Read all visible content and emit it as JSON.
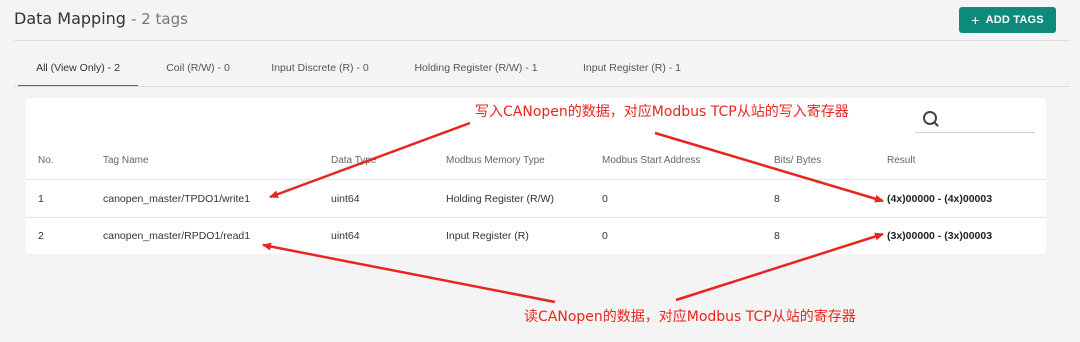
{
  "header": {
    "title": "Data Mapping",
    "subtitle": "- 2 tags",
    "add_button": "ADD TAGS",
    "add_icon": "+"
  },
  "tabs": [
    {
      "label": "All (View Only) - 2",
      "active": true
    },
    {
      "label": "Coil (R/W) - 0",
      "active": false
    },
    {
      "label": "Input Discrete (R) - 0",
      "active": false
    },
    {
      "label": "Holding Register (R/W) - 1",
      "active": false
    },
    {
      "label": "Input Register (R) - 1",
      "active": false
    }
  ],
  "search": {
    "placeholder": "",
    "icon": "search-icon"
  },
  "table": {
    "columns": [
      "No.",
      "Tag Name",
      "Data Type",
      "Modbus Memory Type",
      "Modbus Start Address",
      "Bits/ Bytes",
      "Result"
    ],
    "rows": [
      {
        "no": "1",
        "tag": "canopen_master/TPDO1/write1",
        "type": "uint64",
        "memory": "Holding Register (R/W)",
        "start": "0",
        "bits": "8",
        "result": "(4x)00000 - (4x)00003"
      },
      {
        "no": "2",
        "tag": "canopen_master/RPDO1/read1",
        "type": "uint64",
        "memory": "Input Register (R)",
        "start": "0",
        "bits": "8",
        "result": "(3x)00000 - (3x)00003"
      }
    ]
  },
  "annotations": {
    "top": "写入CANopen的数据，对应Modbus TCP从站的写入寄存器",
    "bottom": "读CANopen的数据，对应Modbus TCP从站的寄存器",
    "color": "#e8251e"
  },
  "colors": {
    "accent": "#0e8a7d"
  }
}
